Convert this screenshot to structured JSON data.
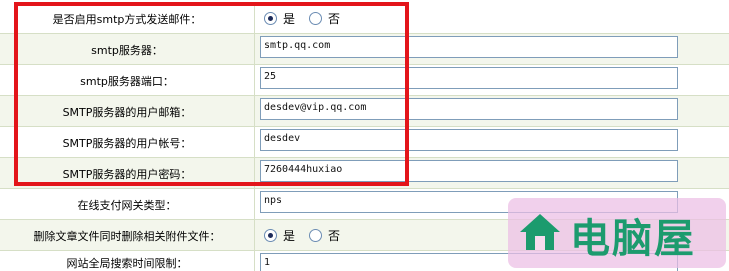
{
  "rows": [
    {
      "label": "是否启用smtp方式发送邮件：",
      "type": "radio",
      "options": [
        "是",
        "否"
      ],
      "selected": "是"
    },
    {
      "label": "smtp服务器：",
      "type": "text",
      "value": "smtp.qq.com"
    },
    {
      "label": "smtp服务器端口：",
      "type": "text",
      "value": "25"
    },
    {
      "label": "SMTP服务器的用户邮箱：",
      "type": "text",
      "value": "desdev@vip.qq.com"
    },
    {
      "label": "SMTP服务器的用户帐号：",
      "type": "text",
      "value": "desdev"
    },
    {
      "label": "SMTP服务器的用户密码：",
      "type": "text",
      "value": "7260444huxiao"
    },
    {
      "label": "在线支付网关类型：",
      "type": "text",
      "value": "nps"
    },
    {
      "label": "删除文章文件同时删除相关附件文件：",
      "type": "radio",
      "options": [
        "是",
        "否"
      ],
      "selected": "是"
    },
    {
      "label": "网站全局搜索时间限制：",
      "type": "text",
      "value": "1"
    }
  ],
  "watermark": {
    "text": "电脑屋"
  },
  "colors": {
    "highlight": "#e3151a",
    "row_alt": "#f3f6ec",
    "border": "#d6dfc6"
  }
}
